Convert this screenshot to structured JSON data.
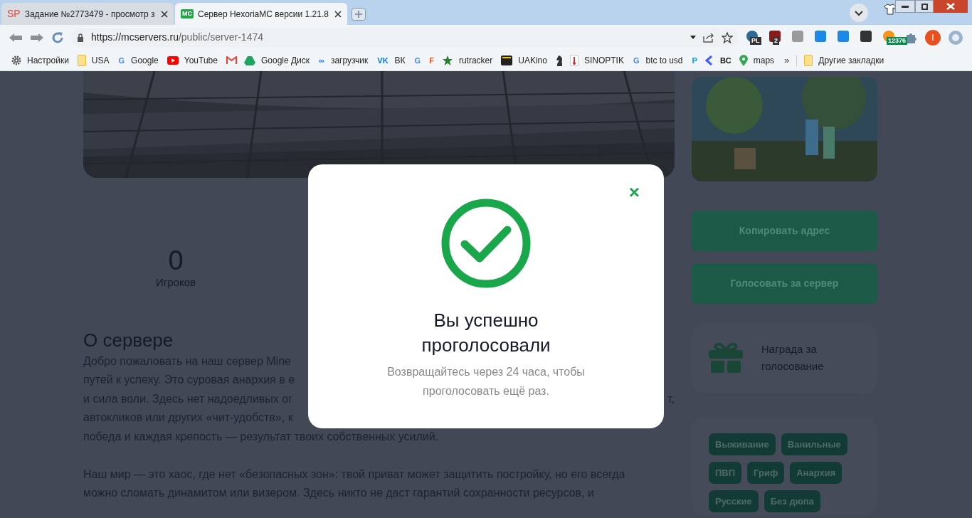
{
  "browser": {
    "tabs": [
      {
        "title": "Задание №2773479 - просмотр з",
        "favicon": "SP",
        "selected": false
      },
      {
        "title": "Сервер HexoriaMC версии 1.21.8",
        "favicon": "MC",
        "selected": true
      }
    ],
    "url_host": "https://mcservers.ru",
    "url_path": "/public/server-1474",
    "extension_badges": [
      "PL",
      "2",
      "12376"
    ],
    "profile_initial": "I",
    "bookmarks": [
      {
        "kind": "labeled",
        "label": "Настройки"
      },
      {
        "kind": "labeled",
        "label": "USA"
      },
      {
        "kind": "labeled",
        "label": "Google",
        "icon_text": "G"
      },
      {
        "kind": "labeled",
        "label": "YouTube"
      },
      {
        "kind": "icon_only"
      },
      {
        "kind": "labeled",
        "label": "Google Диск"
      },
      {
        "kind": "labeled",
        "label": "загрузчик",
        "icon_text": "∞"
      },
      {
        "kind": "labeled",
        "label": "ВК",
        "icon_text": "VK"
      },
      {
        "kind": "icon_only",
        "icon_text": "G"
      },
      {
        "kind": "icon_only",
        "icon_text": "F"
      },
      {
        "kind": "labeled",
        "label": "rutracker"
      },
      {
        "kind": "labeled",
        "label": "UAKino"
      },
      {
        "kind": "icon_only"
      },
      {
        "kind": "labeled",
        "label": "SINOPTIK"
      },
      {
        "kind": "labeled",
        "label": "btc to usd",
        "icon_text": "G"
      },
      {
        "kind": "icon_only",
        "icon_text": "P"
      },
      {
        "kind": "icon_only"
      },
      {
        "kind": "icon_only",
        "icon_text": "BC"
      },
      {
        "kind": "labeled",
        "label": "maps"
      }
    ],
    "more": "»",
    "other_bookmarks": "Другие закладки"
  },
  "page": {
    "stat": {
      "value": "0",
      "label": "Игроков"
    },
    "heading": "О сервере",
    "paragraphs": [
      [
        {
          "left": "Добро пожаловать на наш сервер Mine"
        },
        {
          "left": "путей к успеху. Это суровая анархия в е"
        },
        {
          "left": "и сила воли. Здесь нет надоедливых ог",
          "right": "т,"
        },
        {
          "left": "автокликов или других «чит-удобств», к"
        },
        {
          "left": "победа и каждая крепость — результат твоих собственных усилий."
        }
      ],
      [
        {
          "left": "Наш мир — это хаос, где нет «безопасных зон»: твой приват может защитить постройку, но его всегда"
        },
        {
          "left": "можно сломать динамитом или визером. Здесь никто не даст гарантий сохранности ресурсов, и"
        }
      ]
    ],
    "buttons": [
      "Копировать адрес",
      "Голосовать за сервер"
    ],
    "reward": "Награда за голосование",
    "tags": [
      "Выживание",
      "Ванильные",
      "ПВП",
      "Гриф",
      "Анархия",
      "Русские",
      "Без дюпа"
    ]
  },
  "modal": {
    "title": "Вы успешно проголосовали",
    "message": "Возвращайтесь через 24 часа, чтобы проголосовать ещё раз.",
    "close": "×"
  }
}
